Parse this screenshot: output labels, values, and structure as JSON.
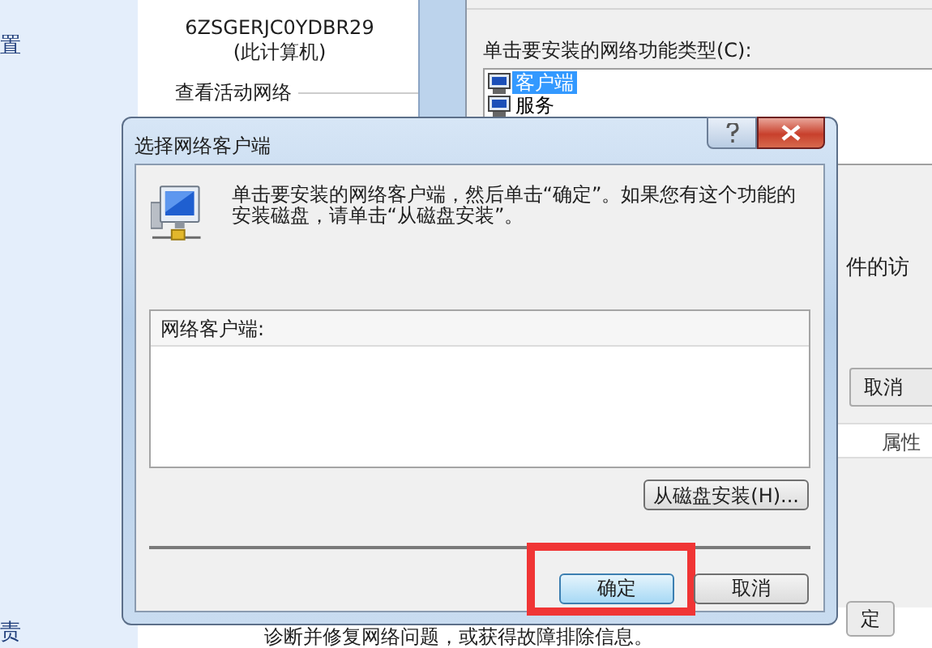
{
  "background": {
    "left_pane": {
      "top_text": "置",
      "bottom_text": "责"
    },
    "network_center": {
      "computer_name": "6ZSGERJC0YDBR29",
      "computer_label": "(此计算机)",
      "section_heading": "查看活动网络",
      "footer_text": "诊断并修复网络问题，或获得故障排除信息。"
    },
    "feature_dialog": {
      "prompt": "单击要安装的网络功能类型(C):",
      "types": [
        {
          "label": "客户端",
          "selected": true
        },
        {
          "label": "服务",
          "selected": false
        }
      ],
      "description_fragment": "件的访",
      "cancel_button": "取消",
      "properties_label": "属性",
      "bottom_button": "定"
    }
  },
  "dialog": {
    "title": "选择网络客户端",
    "message": "单击要安装的网络客户端，然后单击“确定”。如果您有这个功能的安装磁盘，请单击“从磁盘安装”。",
    "list_header": "网络客户端:",
    "have_disk_button": "从磁盘安装(H)...",
    "buttons": [
      {
        "label": "确定",
        "default": true,
        "highlighted": true
      },
      {
        "label": "取消",
        "default": false,
        "highlighted": false
      }
    ]
  }
}
